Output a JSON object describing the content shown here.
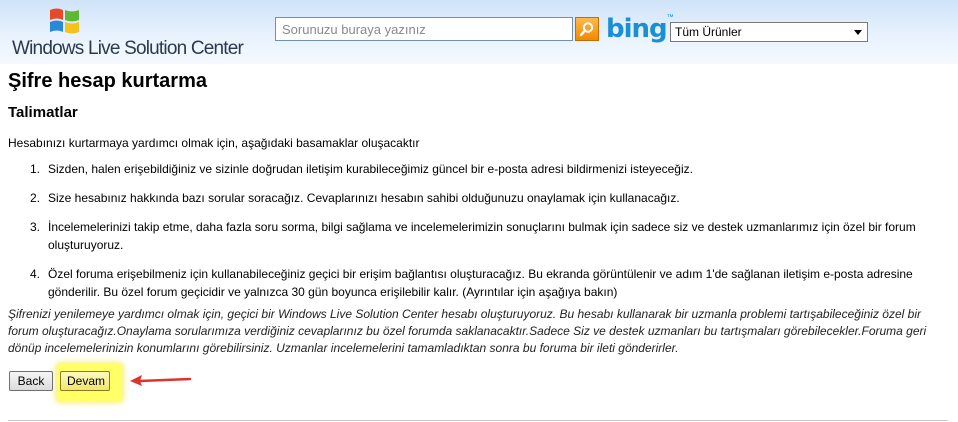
{
  "header": {
    "brand_text": "Windows Live Solution Center",
    "search": {
      "placeholder": "Sorunuzu buraya yazınız",
      "value": ""
    },
    "bing_text": "bing",
    "bing_tm": "™",
    "scope_selected": "Tüm Ürünler"
  },
  "main": {
    "title": "Şifre hesap kurtarma",
    "section_title": "Talimatlar",
    "intro": "Hesabınızı kurtarmaya yardımcı olmak için, aşağıdaki basamaklar oluşacaktır",
    "steps": [
      {
        "num": "1.",
        "text": "Sizden, halen erişebildiğiniz ve sizinle doğrudan iletişim kurabileceğimiz güncel bir e-posta adresi bildirmenizi isteyeceğiz."
      },
      {
        "num": "2.",
        "text": "Size hesabınız hakkında bazı sorular soracağız. Cevaplarınızı hesabın sahibi olduğunuzu onaylamak için kullanacağız."
      },
      {
        "num": "3.",
        "text": "İncelemelerinizi takip etme, daha fazla soru sorma, bilgi sağlama ve incelemelerimizin sonuçlarını bulmak için sadece siz ve destek uzmanlarımız için özel bir forum oluşturuyoruz."
      },
      {
        "num": "4.",
        "text": "Özel foruma erişebilmeniz için kullanabileceğiniz geçici bir erişim bağlantısı oluşturacağız. Bu ekranda görüntülenir ve adım 1'de sağlanan iletişim e-posta adresine gönderilir. Bu özel forum geçicidir ve yalnızca 30 gün boyunca erişilebilir kalır. (Ayrıntılar için aşağıya bakın)"
      }
    ],
    "note": "Şifrenizi yenilemeye yardımcı olmak için, geçici bir Windows Live Solution Center hesabı oluşturuyoruz. Bu hesabı kullanarak bir uzmanla problemi tartışabileceğiniz özel bir forum oluşturacağız.Onaylama sorularımıza verdiğiniz cevaplarınız bu özel forumda saklanacaktır.Sadece Siz ve destek uzmanları bu tartışmaları görebilecekler.Foruma geri dönüp incelemelerinizin konumlarını görebilirsiniz. Uzmanlar incelemelerini tamamladıktan sonra bu foruma bir ileti gönderirler.",
    "back_label": "Back",
    "continue_label": "Devam"
  },
  "colors": {
    "highlight": "#ffff66",
    "annotation_arrow": "#e0312b",
    "bing_blue": "#1b8fd6"
  },
  "icons": {
    "search_button": "magnifier-icon",
    "logo": "windows-flag-icon",
    "annotation": "red-arrow-icon"
  }
}
